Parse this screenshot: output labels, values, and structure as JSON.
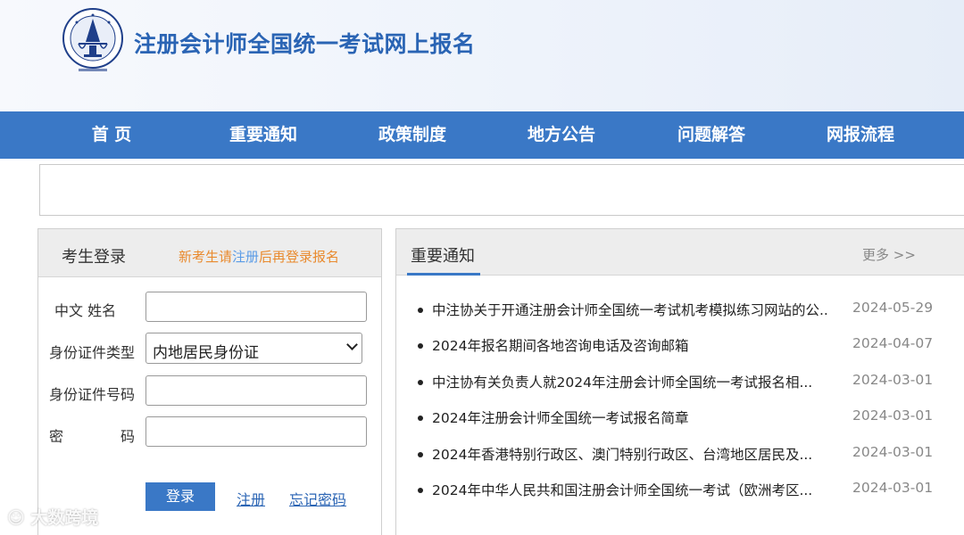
{
  "header": {
    "title": "注册会计师全国统一考试网上报名",
    "logo_icon": "cicpa-emblem-icon"
  },
  "nav": {
    "items": [
      "首 页",
      "重要通知",
      "政策制度",
      "地方公告",
      "问题解答",
      "网报流程"
    ]
  },
  "login": {
    "title": "考生登录",
    "hint_prefix": "新考生请",
    "hint_register": "注册",
    "hint_suffix": "后再登录报名",
    "labels": {
      "name": "中文 姓名",
      "id_type": "身份证件类型",
      "id_number": "身份证件号码",
      "password_1": "密",
      "password_2": "码"
    },
    "id_type_value": "内地居民身份证",
    "login_button": "登录",
    "register_link": "注册",
    "forgot_link": "忘记密码"
  },
  "notice": {
    "title": "重要通知",
    "more": "更多 >>",
    "items": [
      {
        "text": "中注协关于开通注册会计师全国统一考试机考模拟练习网站的公...",
        "date": "2024-05-29"
      },
      {
        "text": "2024年报名期间各地咨询电话及咨询邮箱",
        "date": "2024-04-07"
      },
      {
        "text": "中注协有关负责人就2024年注册会计师全国统一考试报名相...",
        "date": "2024-03-01"
      },
      {
        "text": "2024年注册会计师全国统一考试报名简章",
        "date": "2024-03-01"
      },
      {
        "text": "2024年香港特别行政区、澳门特别行政区、台湾地区居民及...",
        "date": "2024-03-01"
      },
      {
        "text": "2024年中华人民共和国注册会计师全国统一考试（欧洲考区...",
        "date": "2024-03-01"
      }
    ]
  },
  "watermark": "大数跨境",
  "colors": {
    "brand_blue": "#3a78c6",
    "title_blue": "#2a64b4",
    "hint_orange": "#e98a2e"
  }
}
